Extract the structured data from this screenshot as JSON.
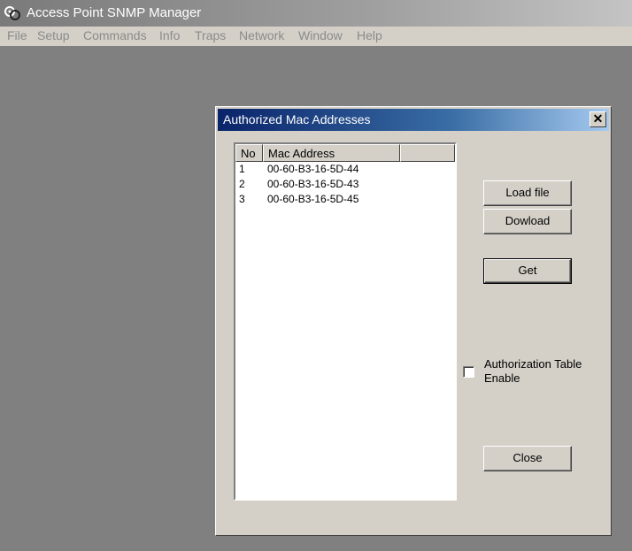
{
  "app": {
    "title": "Access Point SNMP Manager"
  },
  "menu": [
    "File",
    "Setup",
    "Commands",
    "Info",
    "Traps",
    "Network",
    "Window",
    "Help"
  ],
  "dialog": {
    "title": "Authorized Mac Addresses",
    "close_symbol": "✕",
    "columns": [
      "No",
      "Mac Address",
      ""
    ],
    "rows": [
      {
        "no": "1",
        "mac": "00-60-B3-16-5D-44"
      },
      {
        "no": "2",
        "mac": "00-60-B3-16-5D-43"
      },
      {
        "no": "3",
        "mac": "00-60-B3-16-5D-45"
      }
    ],
    "buttons": {
      "load": "Load file",
      "download": "Dowload",
      "get": "Get",
      "close": "Close"
    },
    "checkbox": {
      "label": "Authorization Table Enable",
      "checked": false
    }
  },
  "colors": {
    "desktop": "#808080",
    "face": "#d4d0c8",
    "titlebar_active": "#0a246a"
  }
}
